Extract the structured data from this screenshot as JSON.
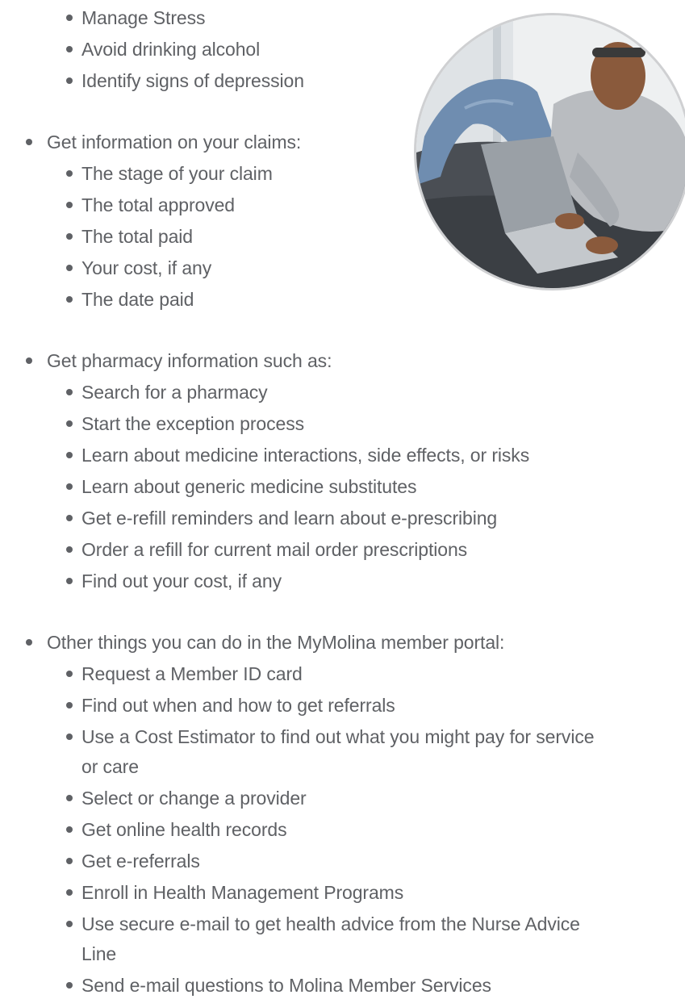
{
  "section1": {
    "items": [
      "Manage Stress",
      "Avoid drinking alcohol",
      "Identify signs of depression"
    ]
  },
  "claims": {
    "heading": "Get information on your claims:",
    "items": [
      "The stage of your claim",
      "The total approved",
      "The total paid",
      "Your cost, if any",
      "The date paid"
    ]
  },
  "pharmacy": {
    "heading": "Get pharmacy information such as:",
    "items": [
      "Search for a pharmacy",
      "Start the exception process",
      "Learn about medicine interactions, side effects, or risks",
      "Learn about generic medicine substitutes",
      "Get e-refill reminders and learn about e-prescribing",
      "Order a refill for current mail order prescriptions",
      "Find out your cost, if any"
    ]
  },
  "portal": {
    "heading": "Other things you can do in the MyMolina member portal:",
    "items": [
      "Request a Member ID card",
      "Find out when and how to get referrals",
      "Use a Cost Estimator to find out what you might pay for service",
      "or care",
      "Select or change a provider",
      "Get online health records",
      "Get e-referrals",
      "Enroll in Health Management Programs",
      "Use secure e-mail to get health advice from the Nurse Advice",
      "Line",
      "Send e-mail questions to Molina Member Services"
    ]
  },
  "photo": {
    "icon": "man-with-laptop-photo"
  },
  "colors": {
    "text": "#5f6165",
    "background": "#ffffff"
  }
}
